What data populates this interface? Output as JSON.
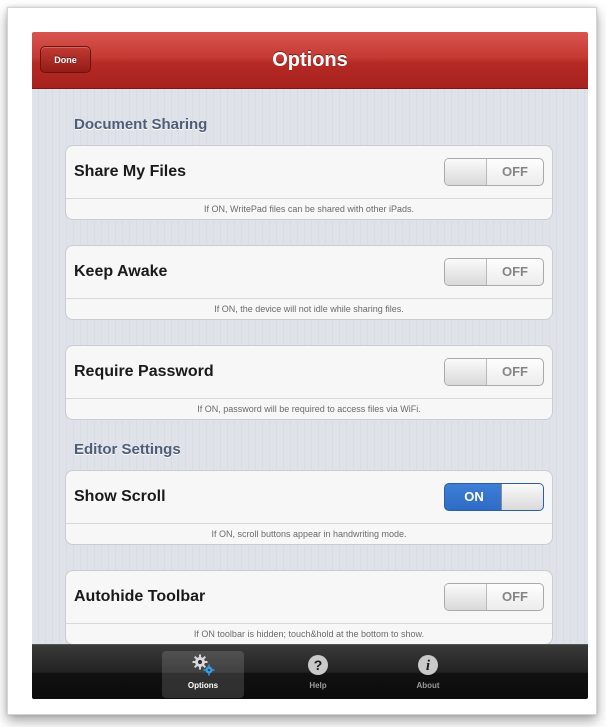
{
  "navbar": {
    "title": "Options",
    "done_label": "Done"
  },
  "sections": {
    "document_sharing": "Document Sharing",
    "editor_settings": "Editor Settings"
  },
  "settings": {
    "share_files": {
      "label": "Share My Files",
      "state": "OFF",
      "note": "If ON, WritePad files can be shared with other iPads."
    },
    "keep_awake": {
      "label": "Keep Awake",
      "state": "OFF",
      "note": "If ON, the device will not idle while sharing files."
    },
    "require_password": {
      "label": "Require Password",
      "state": "OFF",
      "note": "If ON, password will be required to access files via WiFi."
    },
    "show_scroll": {
      "label": "Show Scroll",
      "state": "ON",
      "note": "If ON, scroll buttons appear in handwriting mode."
    },
    "autohide_toolbar": {
      "label": "Autohide Toolbar",
      "state": "OFF",
      "note": "If ON toolbar is hidden; touch&hold at the bottom to show."
    }
  },
  "tabbar": {
    "options": {
      "label": "Options",
      "icon": "gears-icon"
    },
    "help": {
      "label": "Help",
      "icon": "question-icon"
    },
    "about": {
      "label": "About",
      "icon": "info-icon"
    }
  },
  "colors": {
    "navbar": "#c0352f",
    "toggle_on": "#3a78d0",
    "section_title": "#4e5d78"
  }
}
